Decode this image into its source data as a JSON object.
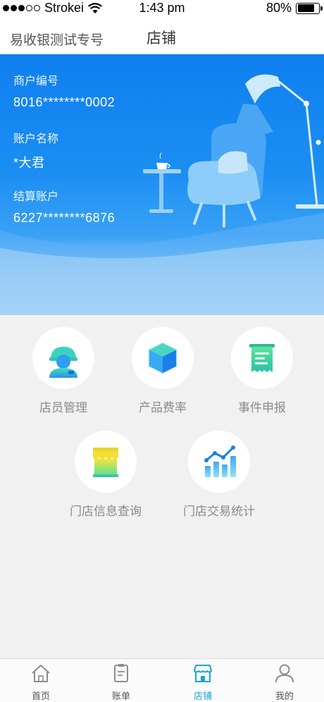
{
  "status_bar": {
    "carrier": "Strokei",
    "time": "1:43 pm",
    "battery": "80%",
    "battery_level": 0.8
  },
  "nav": {
    "left_text": "易收银测试专号",
    "title": "店铺"
  },
  "account": {
    "merchant_no_label": "商户编号",
    "merchant_no": "8016********0002",
    "account_name_label": "账户名称",
    "account_name": "*大君",
    "settlement_label": "结算账户",
    "settlement_account": "6227********6876"
  },
  "menu": {
    "items": [
      {
        "label": "店员管理",
        "icon": "staff-icon"
      },
      {
        "label": "产品费率",
        "icon": "cube-icon"
      },
      {
        "label": "事件申报",
        "icon": "receipt-icon"
      },
      {
        "label": "门店信息查询",
        "icon": "storefront-icon"
      },
      {
        "label": "门店交易统计",
        "icon": "stats-chart-icon"
      }
    ]
  },
  "tabs": [
    {
      "label": "首页",
      "icon": "home-icon"
    },
    {
      "label": "账单",
      "icon": "bill-icon"
    },
    {
      "label": "店铺",
      "icon": "shop-icon",
      "active": true
    },
    {
      "label": "我的",
      "icon": "user-icon"
    }
  ],
  "colors": {
    "primary_blue": "#1b8ef3",
    "active_tab": "#1aa3d9",
    "menu_label": "#8a8a8a"
  }
}
